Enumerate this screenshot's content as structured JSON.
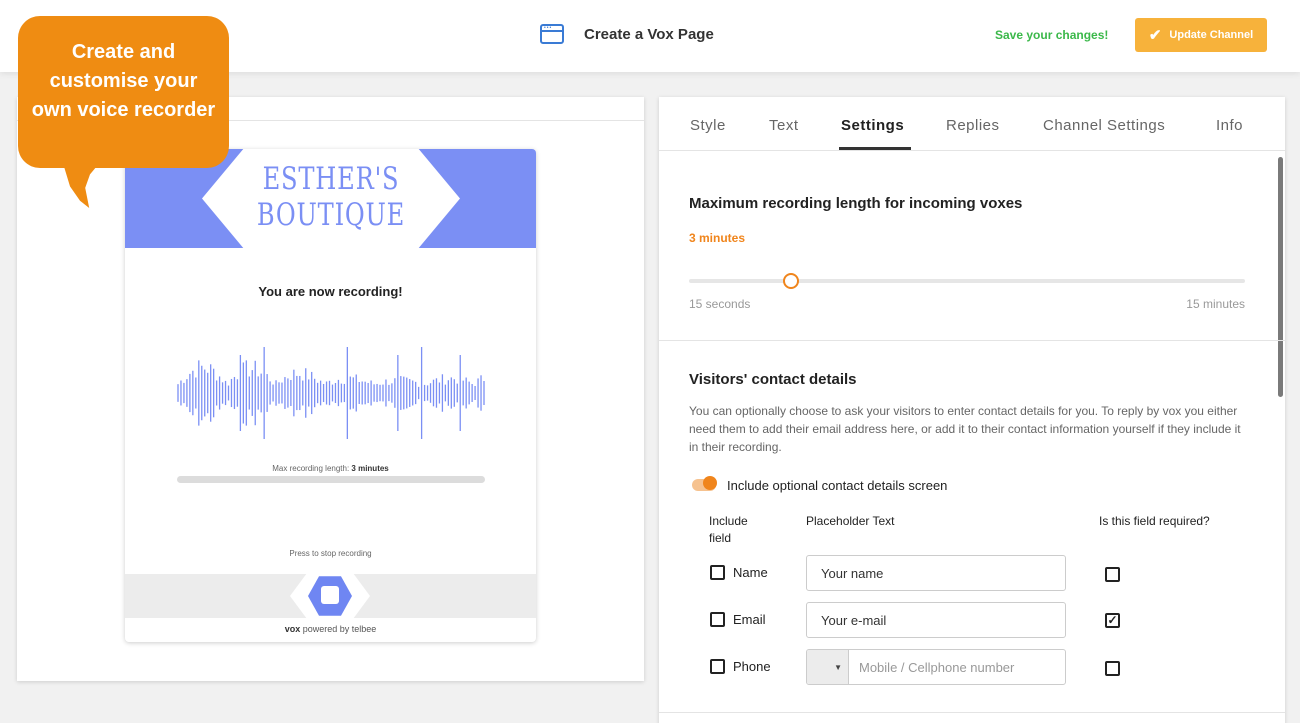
{
  "header": {
    "page_title": "Create a Vox Page",
    "save_notice": "Save your changes!",
    "update_button": "Update Channel",
    "icons": {
      "page": "browser-window-icon",
      "update": "checkmark-icon"
    },
    "colors": {
      "save_notice": "#3bb84a",
      "update_button": "#f7b23b"
    }
  },
  "callout": {
    "lines": [
      "Create and",
      "customise your",
      "own voice recorder"
    ],
    "color": "#ef8c12"
  },
  "preview": {
    "banner": {
      "line1": "ESTHER'S",
      "line2": "BOUTIQUE",
      "color": "#7b8ff4"
    },
    "recording_title": "You are now recording!",
    "max_length_label": "Max recording length: ",
    "max_length_value": "3 minutes",
    "press_stop": "Press to stop recording",
    "powered_brand": "vox",
    "powered_text": " powered by telbee",
    "icons": {
      "stop": "stop-icon"
    },
    "recording_progress": 0
  },
  "settings": {
    "tabs": [
      {
        "label": "Style",
        "active": false
      },
      {
        "label": "Text",
        "active": false
      },
      {
        "label": "Settings",
        "active": true
      },
      {
        "label": "Replies",
        "active": false
      },
      {
        "label": "Channel Settings",
        "active": false
      },
      {
        "label": "Info",
        "active": false
      }
    ],
    "max_length": {
      "title": "Maximum recording length for incoming voxes",
      "value": "3 minutes",
      "min_label": "15 seconds",
      "max_label": "15 minutes",
      "accent": "#f0851c"
    },
    "contact": {
      "title": "Visitors' contact details",
      "description": "You can optionally choose to ask your visitors to enter contact details for you. To reply by vox you either need them to add their email address here, or add it to their contact information yourself if they include it in their recording.",
      "toggle_label": "Include optional contact details screen",
      "toggle_on": true,
      "columns": {
        "include": "Include field",
        "placeholder": "Placeholder Text",
        "required": "Is this field required?"
      },
      "fields": [
        {
          "label": "Name",
          "include": false,
          "placeholder": "Your name",
          "required": false
        },
        {
          "label": "Email",
          "include": false,
          "placeholder": "Your e-mail",
          "required": true
        },
        {
          "label": "Phone",
          "include": false,
          "placeholder": "Mobile / Cellphone number",
          "required": false
        }
      ]
    }
  }
}
